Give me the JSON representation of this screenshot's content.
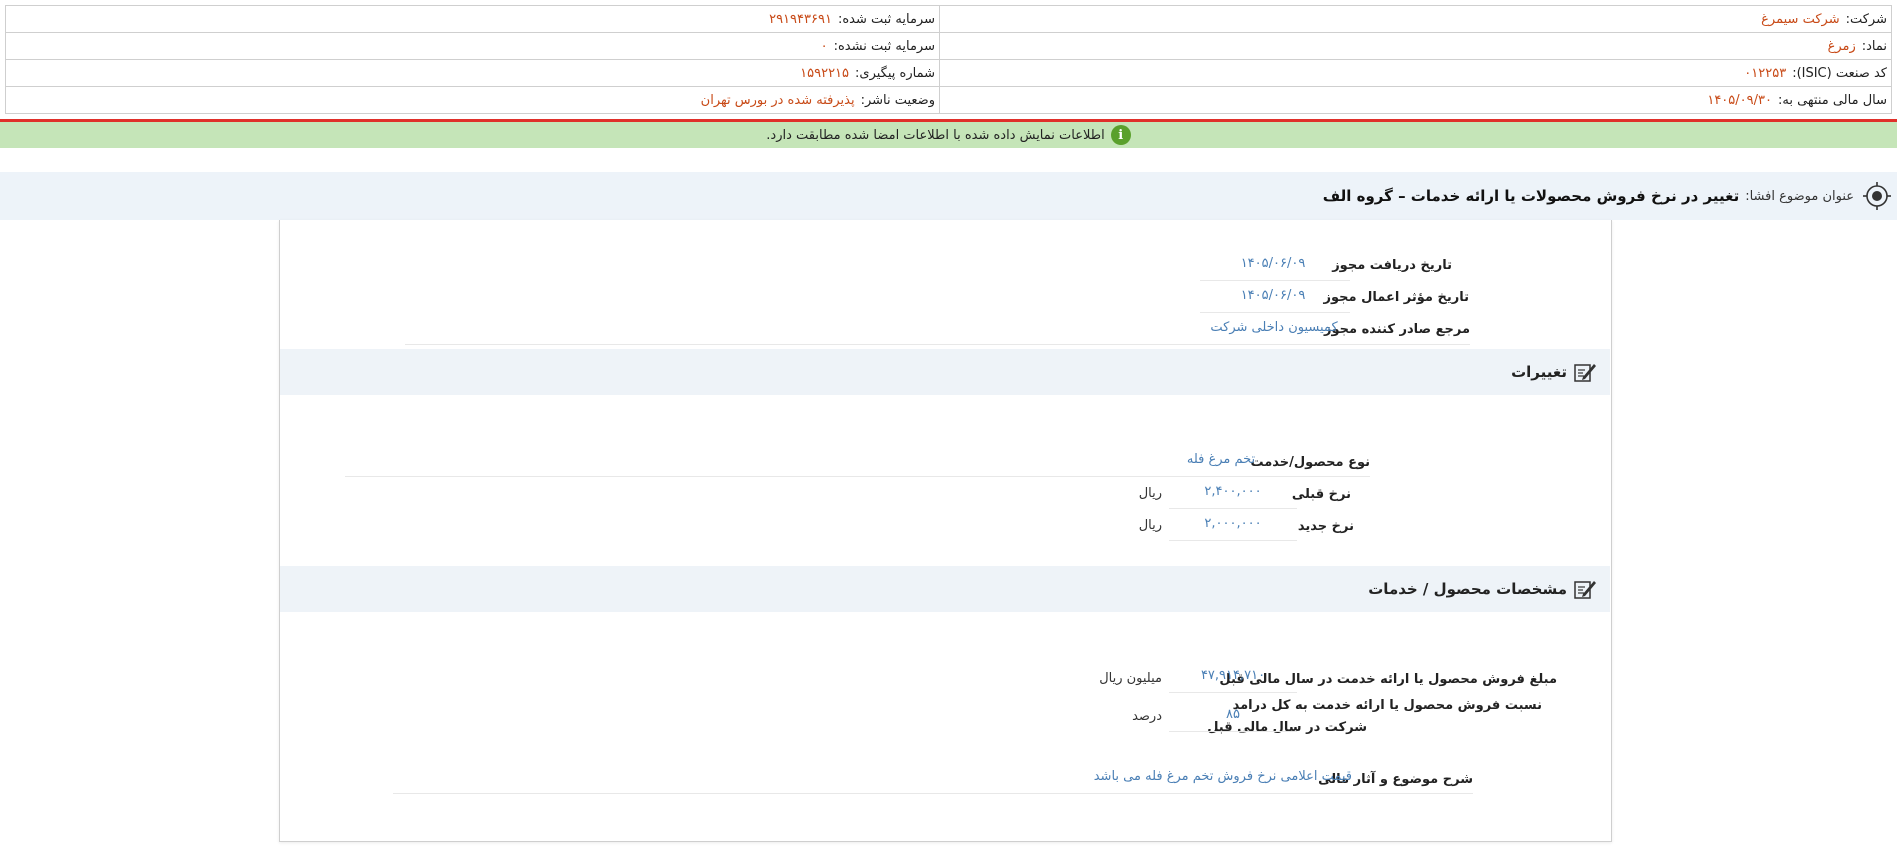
{
  "company_info": {
    "company_label": "شرکت:",
    "company_value": "شرکت سیمرغ",
    "registered_capital_label": "سرمایه ثبت شده:",
    "registered_capital_value": "۲۹۱۹۴۳۶۹۱",
    "symbol_label": "نماد:",
    "symbol_value": "زمرغ",
    "unregistered_capital_label": "سرمایه ثبت نشده:",
    "unregistered_capital_value": "۰",
    "isic_label": "کد صنعت (ISIC):",
    "isic_value": "۰۱۲۲۵۳",
    "tracking_label": "شماره پیگیری:",
    "tracking_value": "۱۵۹۲۲۱۵",
    "fiscal_year_label": "سال مالی منتهی به:",
    "fiscal_year_value": "۱۴۰۵/۰۹/۳۰",
    "publisher_status_label": "وضعیت ناشر:",
    "publisher_status_value": "پذیرفته شده در بورس تهران"
  },
  "notice": {
    "icon": "info-icon",
    "text": "اطلاعات نمایش داده شده با اطلاعات امضا شده مطابقت دارد."
  },
  "disclosure": {
    "subject_label": "عنوان موضوع افشا:",
    "subject_value": "تغییر در نرخ فروش محصولات یا ارائه خدمات – گروه الف"
  },
  "license": {
    "receive_date_label": "تاریخ دریافت مجوز",
    "receive_date_value": "۱۴۰۵/۰۶/۰۹",
    "effective_date_label": "تاریخ مؤثر اعمال مجوز",
    "effective_date_value": "۱۴۰۵/۰۶/۰۹",
    "issuer_label": "مرجع صادر کننده مجوز",
    "issuer_value": "کمیسیون داخلی شرکت"
  },
  "changes": {
    "section_title": "تغییرات",
    "product_type_label": "نوع محصول/خدمت",
    "product_type_value": "تخم مرغ فله",
    "prev_rate_label": "نرخ قبلی",
    "prev_rate_value": "۲,۴۰۰,۰۰۰",
    "prev_rate_unit": "ریال",
    "new_rate_label": "نرخ جدید",
    "new_rate_value": "۲,۰۰۰,۰۰۰",
    "new_rate_unit": "ریال"
  },
  "specs": {
    "section_title": "مشخصات محصول / خدمات",
    "sales_amount_label": "مبلغ فروش محصول یا ارائه خدمت در سال مالی قبل",
    "sales_amount_value": "۴۷,۹۱۴,۷۱۰",
    "sales_amount_unit": "میلیون ریال",
    "ratio_label_line1": "نسبت فروش محصول یا ارائه خدمت به کل درامد",
    "ratio_label_line2": "شرکت در سال مالی قبل",
    "ratio_value": "۸۵",
    "ratio_unit": "درصد",
    "description_label": "شرح موضوع و آثار مالی",
    "description_value": "قیمت اعلامی نرخ فروش تخم مرغ فله می باشد"
  },
  "colors": {
    "accent_value": "#c84a17",
    "link_value": "#4a7fb5",
    "notice_bg": "#c5e5b8",
    "notice_top_border": "#e0302a",
    "title_bar_bg": "#edf3f9",
    "info_icon": "#5aa02c"
  },
  "icons": {
    "title": "target-icon",
    "section": "edit-icon"
  }
}
